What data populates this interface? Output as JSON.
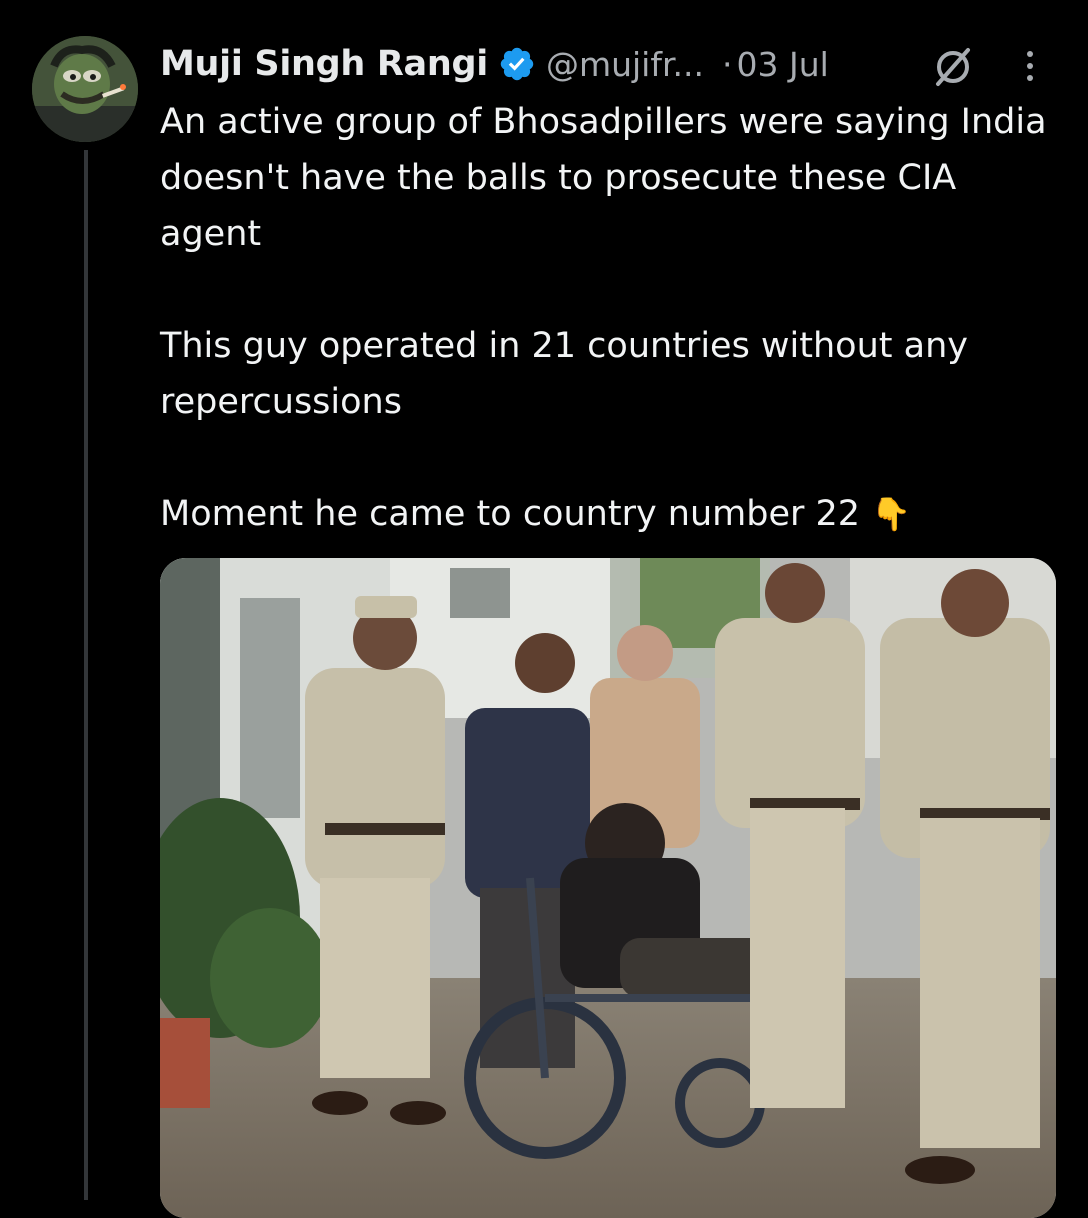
{
  "tweet": {
    "author": {
      "display_name": "Muji Singh Rangi",
      "handle": "@mujifr...",
      "verified": true,
      "avatar_icon": "avatar-image"
    },
    "separator": "·",
    "timestamp": "03 Jul",
    "paragraphs": [
      "An active group of Bhosadpillers were saying India doesn't have the balls to prosecute these CIA agent",
      "This guy operated in 21 countries without any repercussions",
      "Moment he came to country number 22"
    ],
    "emoji": "👇",
    "icons": {
      "verified": "verified-badge-icon",
      "grok": "grok-icon",
      "more": "more-options-icon"
    },
    "media": {
      "type": "photo"
    }
  },
  "colors": {
    "background": "#000000",
    "text": "#e7e9ea",
    "secondary_text": "#a8acb1",
    "verified_blue": "#1d9bf0",
    "thread_line": "#333639"
  }
}
